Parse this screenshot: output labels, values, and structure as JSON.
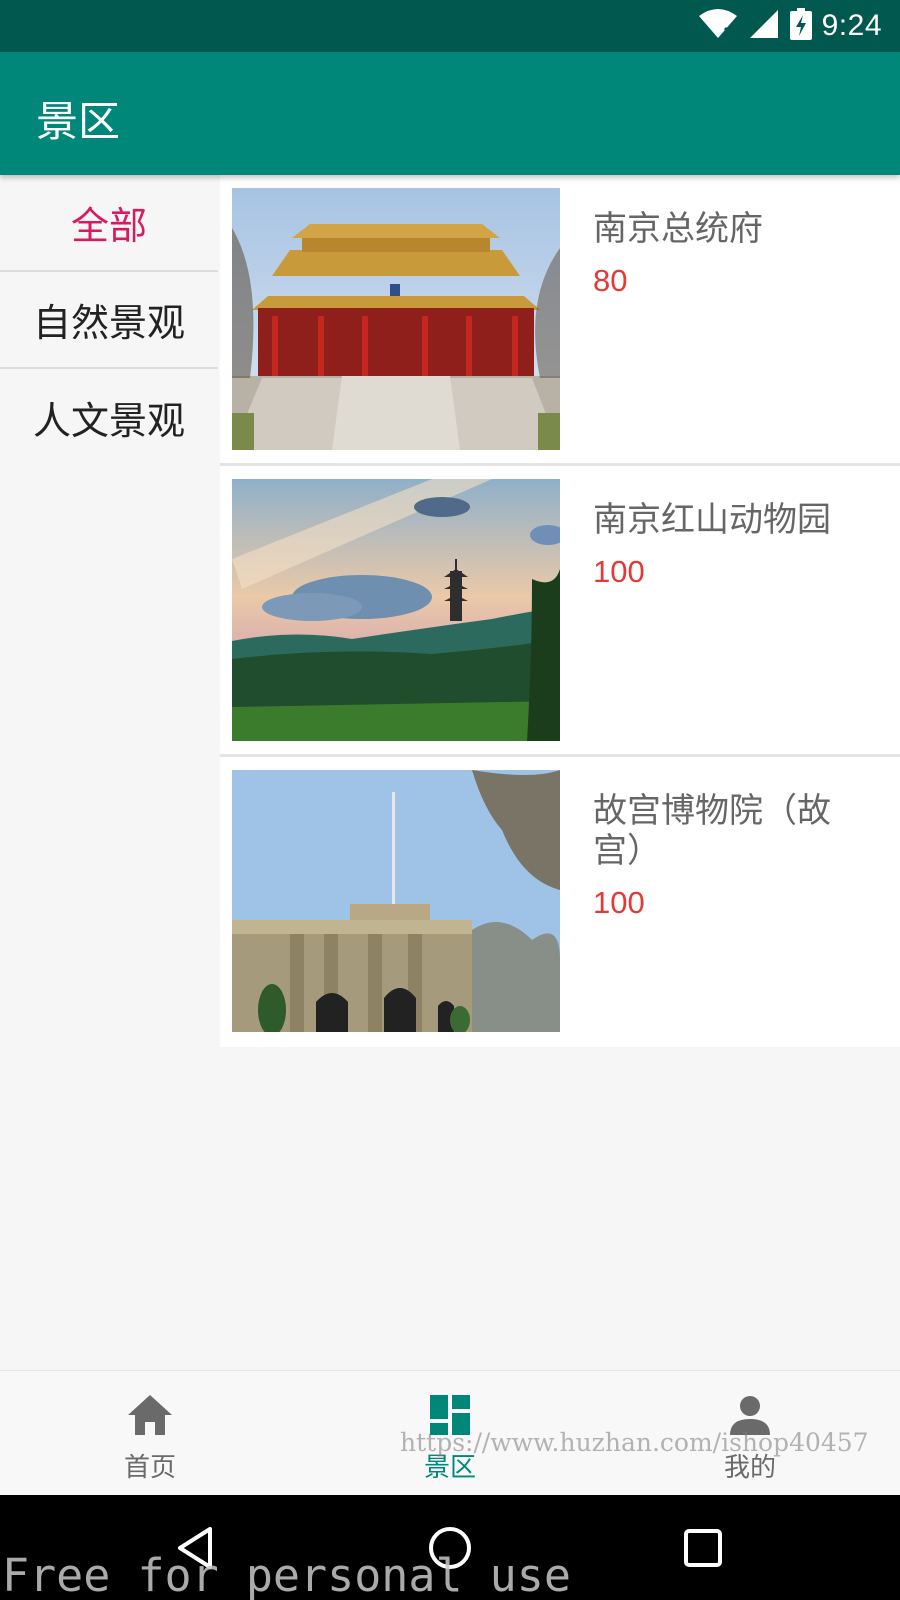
{
  "status_bar": {
    "time": "9:24",
    "icons": [
      "wifi-icon",
      "signal-icon",
      "battery-charging-icon"
    ]
  },
  "app_bar": {
    "title": "景区"
  },
  "sidebar": {
    "categories": [
      {
        "label": "全部",
        "active": true
      },
      {
        "label": "自然景观",
        "active": false
      },
      {
        "label": "人文景观",
        "active": false
      }
    ]
  },
  "scenic_list": [
    {
      "name": "南京总统府",
      "price": "80",
      "image": "temple-photo"
    },
    {
      "name": "南京红山动物园",
      "price": "100",
      "image": "pagoda-sunset-photo"
    },
    {
      "name": "故宫博物院（故宫）",
      "price": "100",
      "image": "historic-gate-photo"
    }
  ],
  "bottom_nav": {
    "items": [
      {
        "label": "首页",
        "icon": "home-icon",
        "active": false
      },
      {
        "label": "景区",
        "icon": "dashboard-icon",
        "active": true
      },
      {
        "label": "我的",
        "icon": "person-icon",
        "active": false
      }
    ]
  },
  "watermarks": {
    "url": "https://www.huzhan.com/ishop40457",
    "license": "Free for personal use"
  },
  "colors": {
    "primary": "#00877a",
    "primary_dark": "#00584e",
    "accent": "#d81b60",
    "price": "#e53935"
  }
}
